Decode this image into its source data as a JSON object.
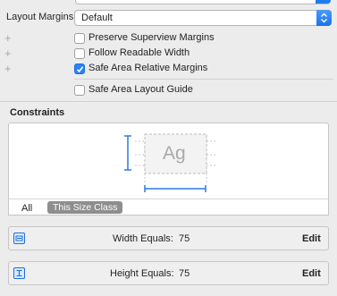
{
  "layout_margins": {
    "label": "Layout Margins",
    "value": "Default"
  },
  "checkboxes": [
    {
      "label": "Preserve Superview Margins",
      "checked": false
    },
    {
      "label": "Follow Readable Width",
      "checked": false
    },
    {
      "label": "Safe Area Relative Margins",
      "checked": true
    },
    {
      "label": "Safe Area Layout Guide",
      "checked": false
    }
  ],
  "constraints": {
    "title": "Constraints",
    "preview_text": "Ag",
    "size_class_options": [
      "All",
      "This Size Class"
    ],
    "selected_size_class": "This Size Class",
    "rows": [
      {
        "label": "Width Equals:",
        "value": "75",
        "action": "Edit",
        "icon": "width-constraint-icon"
      },
      {
        "label": "Height Equals:",
        "value": "75",
        "action": "Edit",
        "icon": "height-constraint-icon"
      }
    ]
  },
  "colors": {
    "accent": "#1f7cf5",
    "selected_segment": "#8e8e8e",
    "constraint_blue": "#1f6fd8"
  }
}
